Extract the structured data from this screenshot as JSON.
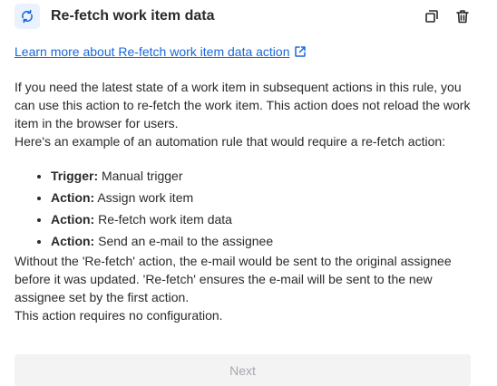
{
  "header": {
    "title": "Re-fetch work item data",
    "icon": "refresh-icon",
    "actions": [
      "duplicate-icon",
      "trash-icon"
    ]
  },
  "link": {
    "text": "Learn more about Re-fetch work item data action",
    "icon": "external-link-icon"
  },
  "description": {
    "line1": "If you need the latest state of a work item in subsequent actions in this rule, you can use this action to re-fetch the work item. This action does not reload the work item in the browser for users.",
    "line2": "Here's an example of an automation rule that would require a re-fetch action:",
    "items": [
      {
        "label": "Trigger:",
        "text": " Manual trigger"
      },
      {
        "label": "Action:",
        "text": " Assign work item"
      },
      {
        "label": "Action:",
        "text": " Re-fetch work item data"
      },
      {
        "label": "Action:",
        "text": " Send an e-mail to the assignee"
      }
    ],
    "line3": "Without the 'Re-fetch' action, the e-mail would be sent to the original assignee before it was updated. 'Re-fetch' ensures the e-mail will be sent to the new assignee set by the first action.",
    "line4": "This action requires no configuration."
  },
  "footer": {
    "next_label": "Next"
  },
  "colors": {
    "link": "#1868db",
    "icon_accent": "#1868db",
    "icon_bg": "#e9f2fe",
    "disabled_bg": "#f3f3f4",
    "disabled_text": "#a5a8ad"
  }
}
